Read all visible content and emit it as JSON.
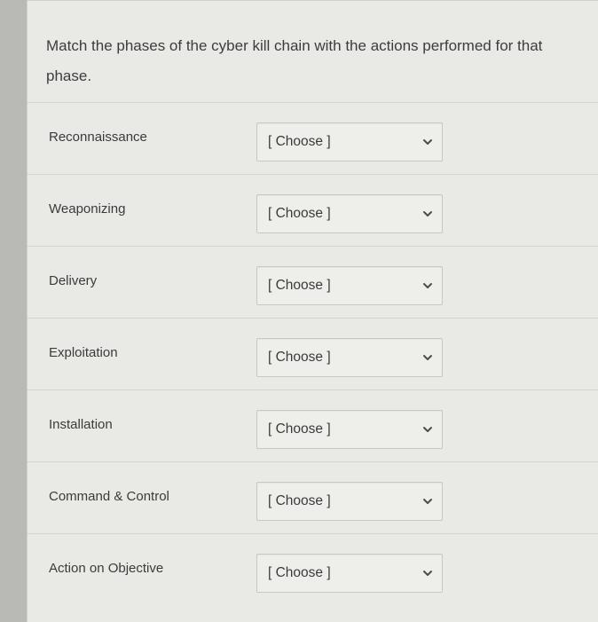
{
  "question": {
    "text": "Match the phases of the cyber kill chain with the actions performed for that phase."
  },
  "rows": [
    {
      "label": "Reconnaissance",
      "selected": "[ Choose ]"
    },
    {
      "label": "Weaponizing",
      "selected": "[ Choose ]"
    },
    {
      "label": "Delivery",
      "selected": "[ Choose ]"
    },
    {
      "label": "Exploitation",
      "selected": "[ Choose ]"
    },
    {
      "label": "Installation",
      "selected": "[ Choose ]"
    },
    {
      "label": "Command & Control",
      "selected": "[ Choose ]"
    },
    {
      "label": "Action on Objective",
      "selected": "[ Choose ]"
    }
  ],
  "icons": {
    "dropdown": "chevron-down-icon"
  },
  "colors": {
    "card_background": "#e9eae5",
    "text": "#3a3b3c"
  }
}
